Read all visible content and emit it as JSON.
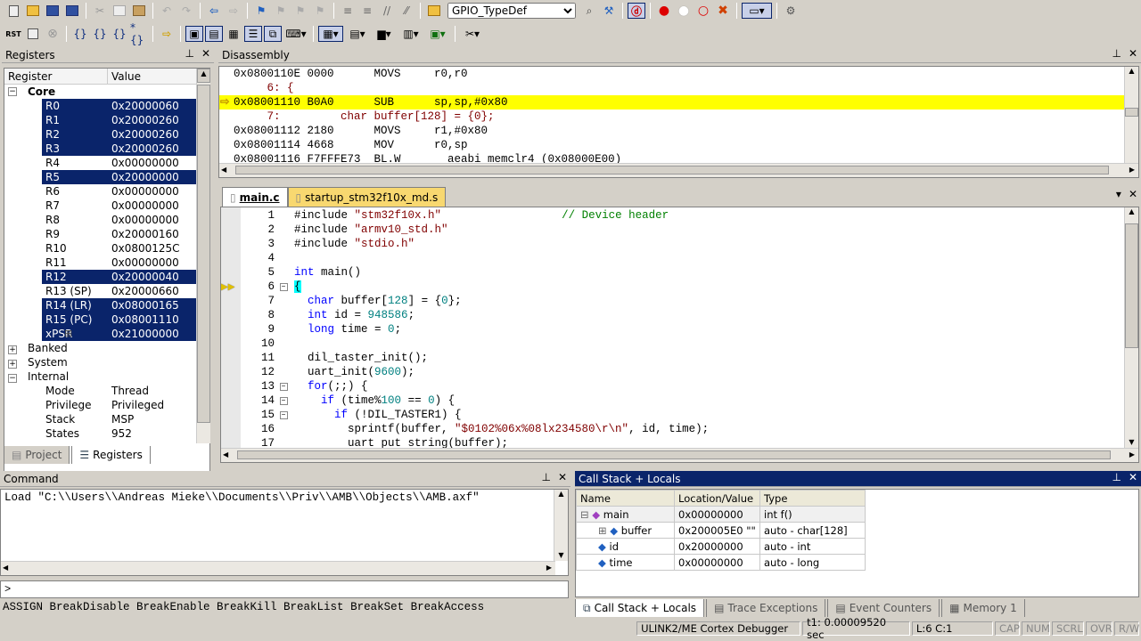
{
  "toolbar1": {
    "target_select": "GPIO_TypeDef",
    "icons": [
      "new-file-icon",
      "open-folder-icon",
      "save-icon",
      "save-all-icon",
      "cut-icon",
      "copy-icon",
      "paste-icon",
      "undo-icon",
      "redo-icon",
      "back-icon",
      "forward-icon",
      "bookmark-icon",
      "prev-bookmark-icon",
      "next-bookmark-icon",
      "clear-bookmarks-icon",
      "indent-icon",
      "unindent-icon",
      "comment-icon",
      "uncomment-icon",
      "find-in-files-icon",
      "find-icon",
      "incremental-find-icon",
      "debug-session-icon",
      "breakpoint-icon",
      "disable-breakpoint-icon",
      "kill-breakpoints-icon",
      "kill-all-breakpoints-icon",
      "window-layout-icon",
      "configure-icon"
    ]
  },
  "toolbar2": {
    "icons": [
      "reset-icon",
      "run-icon",
      "stop-icon",
      "step-into-icon",
      "step-over-icon",
      "step-out-icon",
      "run-to-cursor-icon",
      "show-next-statement-icon",
      "command-window-icon",
      "disassembly-window-icon",
      "symbols-window-icon",
      "registers-window-icon",
      "call-stack-window-icon",
      "watch-windows-icon",
      "memory-windows-icon",
      "serial-windows-icon",
      "analysis-windows-icon",
      "trace-windows-icon",
      "system-viewer-icon",
      "toolbox-icon"
    ]
  },
  "registers": {
    "title": "Registers",
    "col_register": "Register",
    "col_value": "Value",
    "core_label": "Core",
    "rows": [
      {
        "name": "R0",
        "value": "0x20000060",
        "selected": true
      },
      {
        "name": "R1",
        "value": "0x20000260",
        "selected": true
      },
      {
        "name": "R2",
        "value": "0x20000260",
        "selected": true
      },
      {
        "name": "R3",
        "value": "0x20000260",
        "selected": true
      },
      {
        "name": "R4",
        "value": "0x00000000",
        "selected": false
      },
      {
        "name": "R5",
        "value": "0x20000000",
        "selected": true
      },
      {
        "name": "R6",
        "value": "0x00000000",
        "selected": false
      },
      {
        "name": "R7",
        "value": "0x00000000",
        "selected": false
      },
      {
        "name": "R8",
        "value": "0x00000000",
        "selected": false
      },
      {
        "name": "R9",
        "value": "0x20000160",
        "selected": false
      },
      {
        "name": "R10",
        "value": "0x0800125C",
        "selected": false
      },
      {
        "name": "R11",
        "value": "0x00000000",
        "selected": false
      },
      {
        "name": "R12",
        "value": "0x20000040",
        "selected": true
      },
      {
        "name": "R13 (SP)",
        "value": "0x20000660",
        "selected": false
      },
      {
        "name": "R14 (LR)",
        "value": "0x08000165",
        "selected": true
      },
      {
        "name": "R15 (PC)",
        "value": "0x08001110",
        "selected": true
      },
      {
        "name": "xPSR",
        "value": "0x21000000",
        "selected": true
      }
    ],
    "groups": [
      "Banked",
      "System",
      "Internal"
    ],
    "internal": [
      {
        "name": "Mode",
        "value": "Thread"
      },
      {
        "name": "Privilege",
        "value": "Privileged"
      },
      {
        "name": "Stack",
        "value": "MSP"
      },
      {
        "name": "States",
        "value": "952"
      }
    ],
    "tabs": [
      "Project",
      "Registers"
    ]
  },
  "disassembly": {
    "title": "Disassembly",
    "lines": [
      {
        "text": "0x0800110E 0000      MOVS     r0,r0",
        "type": "asm"
      },
      {
        "text": "     6: {",
        "type": "src"
      },
      {
        "text": "0x08001110 B0A0      SUB      sp,sp,#0x80",
        "type": "current"
      },
      {
        "text": "     7:         char buffer[128] = {0};",
        "type": "src"
      },
      {
        "text": "0x08001112 2180      MOVS     r1,#0x80",
        "type": "asm"
      },
      {
        "text": "0x08001114 4668      MOV      r0,sp",
        "type": "asm"
      },
      {
        "text": "0x08001116 F7FFFE73  BL.W       aeabi memclr4 (0x08000E00)",
        "type": "asm"
      }
    ]
  },
  "editor": {
    "tabs": [
      "main.c",
      "startup_stm32f10x_md.s"
    ],
    "lines": [
      {
        "n": "1",
        "html": "#include <span class='str'>\"stm32f10x.h\"</span>                  <span class='cmt'>// Device header</span>"
      },
      {
        "n": "2",
        "html": "#include <span class='str'>\"armv10_std.h\"</span>"
      },
      {
        "n": "3",
        "html": "#include <span class='str'>\"stdio.h\"</span>"
      },
      {
        "n": "4",
        "html": ""
      },
      {
        "n": "5",
        "html": "<span class='kw'>int</span> main()"
      },
      {
        "n": "6",
        "html": "<span style='background:#00ffff'>{</span>"
      },
      {
        "n": "7",
        "html": "  <span class='kw'>char</span> buffer[<span class='num'>128</span>] = {<span class='num'>0</span>};"
      },
      {
        "n": "8",
        "html": "  <span class='kw'>int</span> id = <span class='num'>948586</span>;"
      },
      {
        "n": "9",
        "html": "  <span class='kw'>long</span> time = <span class='num'>0</span>;"
      },
      {
        "n": "10",
        "html": ""
      },
      {
        "n": "11",
        "html": "  dil_taster_init();"
      },
      {
        "n": "12",
        "html": "  uart_init(<span class='num'>9600</span>);"
      },
      {
        "n": "13",
        "html": "  <span class='kw'>for</span>(;;) {"
      },
      {
        "n": "14",
        "html": "    <span class='kw'>if</span> (time%<span class='num'>100</span> == <span class='num'>0</span>) {"
      },
      {
        "n": "15",
        "html": "      <span class='kw'>if</span> (!DIL_TASTER1) {"
      },
      {
        "n": "16",
        "html": "        sprintf(buffer, <span class='str'>\"$0102%06x%08lx234580\\r\\n\"</span>, id, time);"
      },
      {
        "n": "17",
        "html": "        uart put string(buffer);"
      }
    ]
  },
  "command": {
    "title": "Command",
    "output": "Load \"C:\\\\Users\\\\Andreas Mieke\\\\Documents\\\\Priv\\\\AMB\\\\Objects\\\\AMB.axf\"",
    "prompt": ">",
    "hints": "ASSIGN BreakDisable BreakEnable BreakKill BreakList BreakSet BreakAccess"
  },
  "callstack": {
    "title": "Call Stack + Locals",
    "cols": [
      "Name",
      "Location/Value",
      "Type"
    ],
    "rows": [
      {
        "name": "main",
        "value": "0x00000000",
        "type": "int f()"
      },
      {
        "name": "buffer",
        "value": "0x200005E0 \"\"",
        "type": "auto - char[128]"
      },
      {
        "name": "id",
        "value": "0x20000000",
        "type": "auto - int"
      },
      {
        "name": "time",
        "value": "0x00000000",
        "type": "auto - long"
      }
    ],
    "tabs": [
      "Call Stack + Locals",
      "Trace Exceptions",
      "Event Counters",
      "Memory 1"
    ]
  },
  "status": {
    "debugger": "ULINK2/ME Cortex Debugger",
    "time": "t1: 0.00009520 sec",
    "pos": "L:6 C:1",
    "flags": [
      "CAP",
      "NUM",
      "SCRL",
      "OVR",
      "R/W"
    ]
  }
}
